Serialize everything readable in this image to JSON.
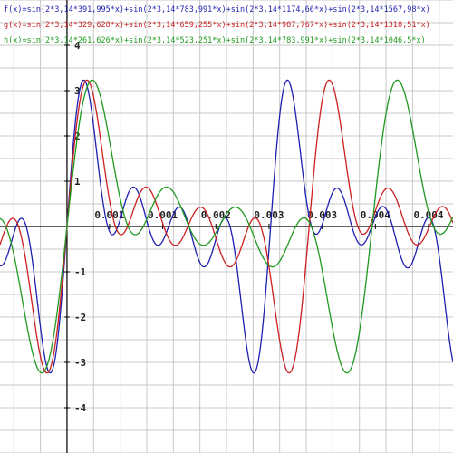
{
  "chart_data": {
    "type": "line",
    "title": "",
    "xlabel": "",
    "ylabel": "",
    "grid": true,
    "xlim": [
      -0.00084,
      0.00484
    ],
    "ylim": [
      -5,
      5
    ],
    "x_tick_labels": [
      "0.001",
      "0.001",
      "0.002",
      "0.003",
      "0.003",
      "0.004",
      "0.004"
    ],
    "x_tick_values": [
      0.0005333,
      0.0012,
      0.0018667,
      0.0025333,
      0.0032,
      0.0038667,
      0.0045333
    ],
    "y_tick_labels": [
      "4",
      "3",
      "2",
      "1",
      "-1",
      "-2",
      "-3",
      "-4"
    ],
    "y_tick_values": [
      4,
      3,
      2,
      1,
      -1,
      -2,
      -3,
      -4
    ],
    "legend_placement": "top-left",
    "series": [
      {
        "name": "f(x)=sin(2*3,14*391,995*x)+sin(2*3,14*783,991*x)+sin(2*3,14*1174,66*x)+sin(2*3,14*1567,98*x)",
        "color": "#1f1fb0",
        "frequencies": [
          391.995,
          783.991,
          1174.66,
          1567.98
        ]
      },
      {
        "name": "g(x)=sin(2*3,14*329,628*x)+sin(2*3,14*659,255*x)+sin(2*3,14*987,767*x)+sin(2*3,14*1318,51*x)",
        "color": "#cc1f1f",
        "frequencies": [
          329.628,
          659.255,
          987.767,
          1318.51
        ]
      },
      {
        "name": "h(x)=sin(2*3,14*261,626*x)+sin(2*3,14*523,251*x)+sin(2*3,14*783,991*x)+sin(2*3,14*1046,5*x)",
        "color": "#1f9a1f",
        "frequencies": [
          261.626,
          523.251,
          783.991,
          1046.5
        ]
      }
    ]
  }
}
